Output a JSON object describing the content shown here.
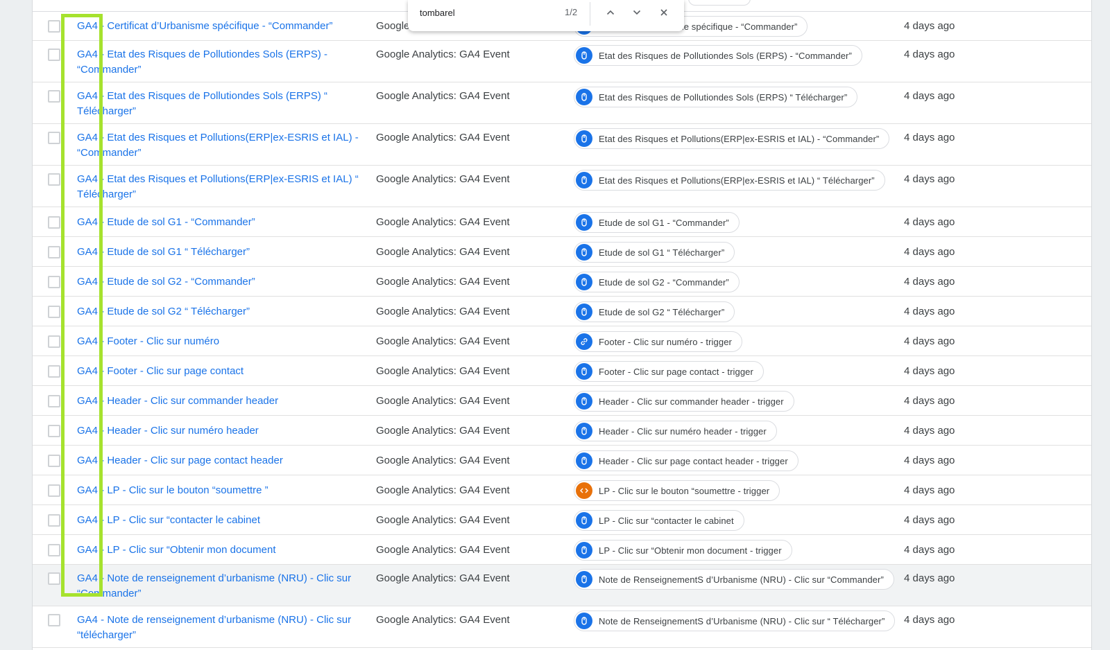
{
  "find_bar": {
    "query": "tombarel",
    "count": "1/2",
    "prev_icon": "chevron-up-icon",
    "next_icon": "chevron-down-icon",
    "close_icon": "close-icon"
  },
  "colors": {
    "link": "#1a73e8",
    "trigger_blue": "#1a73e8",
    "trigger_orange": "#e8710a",
    "highlight": "#a6e22e"
  },
  "rows": [
    {
      "name": "GA4 - Certificat d’Urbanisme spécifique - “Commander”",
      "type": "Google Analytics: GA4 Event",
      "trigger": "Certificat d’Urbanisme spécifique - “Commander”",
      "trigger_icon": "pointer-icon",
      "modified": "4 days ago"
    },
    {
      "name": "GA4 - Etat des Risques de Pollutiondes Sols (ERPS) - “Commander”",
      "type": "Google Analytics: GA4 Event",
      "trigger": "Etat des Risques de Pollutiondes Sols (ERPS) - “Commander”",
      "trigger_icon": "pointer-icon",
      "modified": "4 days ago"
    },
    {
      "name": "GA4 - Etat des Risques de Pollutiondes Sols (ERPS) “ Télécharger”",
      "type": "Google Analytics: GA4 Event",
      "trigger": "Etat des Risques de Pollutiondes Sols (ERPS) “ Télécharger”",
      "trigger_icon": "pointer-icon",
      "modified": "4 days ago"
    },
    {
      "name": "GA4 - Etat des Risques et Pollutions(ERP|ex-ESRIS et IAL) - “Commander”",
      "type": "Google Analytics: GA4 Event",
      "trigger": "Etat des Risques et Pollutions(ERP|ex-ESRIS et IAL) - “Commander”",
      "trigger_icon": "pointer-icon",
      "modified": "4 days ago"
    },
    {
      "name": "GA4 - Etat des Risques et Pollutions(ERP|ex-ESRIS et IAL) “ Télécharger”",
      "type": "Google Analytics: GA4 Event",
      "trigger": "Etat des Risques et Pollutions(ERP|ex-ESRIS et IAL) “ Télécharger”",
      "trigger_icon": "pointer-icon",
      "modified": "4 days ago"
    },
    {
      "name": "GA4 - Etude de sol G1 - “Commander”",
      "type": "Google Analytics: GA4 Event",
      "trigger": "Etude de sol G1 - “Commander”",
      "trigger_icon": "pointer-icon",
      "modified": "4 days ago"
    },
    {
      "name": "GA4 - Etude de sol G1 “ Télécharger”",
      "type": "Google Analytics: GA4 Event",
      "trigger": "Etude de sol G1 “ Télécharger”",
      "trigger_icon": "pointer-icon",
      "modified": "4 days ago"
    },
    {
      "name": "GA4 - Etude de sol G2 - “Commander”",
      "type": "Google Analytics: GA4 Event",
      "trigger": "Etude de sol G2 - “Commander”",
      "trigger_icon": "pointer-icon",
      "modified": "4 days ago"
    },
    {
      "name": "GA4 - Etude de sol G2 “ Télécharger”",
      "type": "Google Analytics: GA4 Event",
      "trigger": "Etude de sol G2 “ Télécharger”",
      "trigger_icon": "pointer-icon",
      "modified": "4 days ago"
    },
    {
      "name": "GA4 - Footer - Clic sur numéro",
      "type": "Google Analytics: GA4 Event",
      "trigger": "Footer - Clic sur numéro - trigger",
      "trigger_icon": "link-icon",
      "modified": "4 days ago"
    },
    {
      "name": "GA4 - Footer - Clic sur page contact",
      "type": "Google Analytics: GA4 Event",
      "trigger": "Footer - Clic sur page contact - trigger",
      "trigger_icon": "pointer-icon",
      "modified": "4 days ago"
    },
    {
      "name": "GA4 - Header - Clic sur commander header",
      "type": "Google Analytics: GA4 Event",
      "trigger": "Header - Clic sur commander header - trigger",
      "trigger_icon": "pointer-icon",
      "modified": "4 days ago"
    },
    {
      "name": "GA4 - Header - Clic sur numéro header",
      "type": "Google Analytics: GA4 Event",
      "trigger": "Header - Clic sur numéro header - trigger",
      "trigger_icon": "pointer-icon",
      "modified": "4 days ago"
    },
    {
      "name": "GA4 - Header - Clic sur page contact header",
      "type": "Google Analytics: GA4 Event",
      "trigger": "Header - Clic sur page contact header - trigger",
      "trigger_icon": "pointer-icon",
      "modified": "4 days ago"
    },
    {
      "name": "GA4 - LP - Clic sur le bouton “soumettre ”",
      "type": "Google Analytics: GA4 Event",
      "trigger": "LP - Clic sur le bouton “soumettre - trigger",
      "trigger_icon": "code-icon",
      "modified": "4 days ago"
    },
    {
      "name": "GA4 - LP - Clic sur “contacter le cabinet",
      "type": "Google Analytics: GA4 Event",
      "trigger": "LP - Clic sur “contacter le cabinet",
      "trigger_icon": "pointer-icon",
      "modified": "4 days ago"
    },
    {
      "name": "GA4 - LP - Clic sur “Obtenir mon document",
      "type": "Google Analytics: GA4 Event",
      "trigger": "LP - Clic sur “Obtenir mon document - trigger",
      "trigger_icon": "pointer-icon",
      "modified": "4 days ago"
    },
    {
      "name": "GA4 - Note de renseignement d’urbanisme (NRU) - Clic sur “Commander”",
      "type": "Google Analytics: GA4 Event",
      "trigger": "Note de RenseignementS d’Urbanisme (NRU) - Clic sur “Commander”",
      "trigger_icon": "pointer-icon",
      "modified": "4 days ago"
    },
    {
      "name": "GA4 - Note de renseignement d’urbanisme (NRU) - Clic sur “télécharger”",
      "type": "Google Analytics: GA4 Event",
      "trigger": "Note de RenseignementS d’Urbanisme (NRU) - Clic sur “ Télécharger”",
      "trigger_icon": "pointer-icon",
      "modified": "4 days ago"
    }
  ]
}
